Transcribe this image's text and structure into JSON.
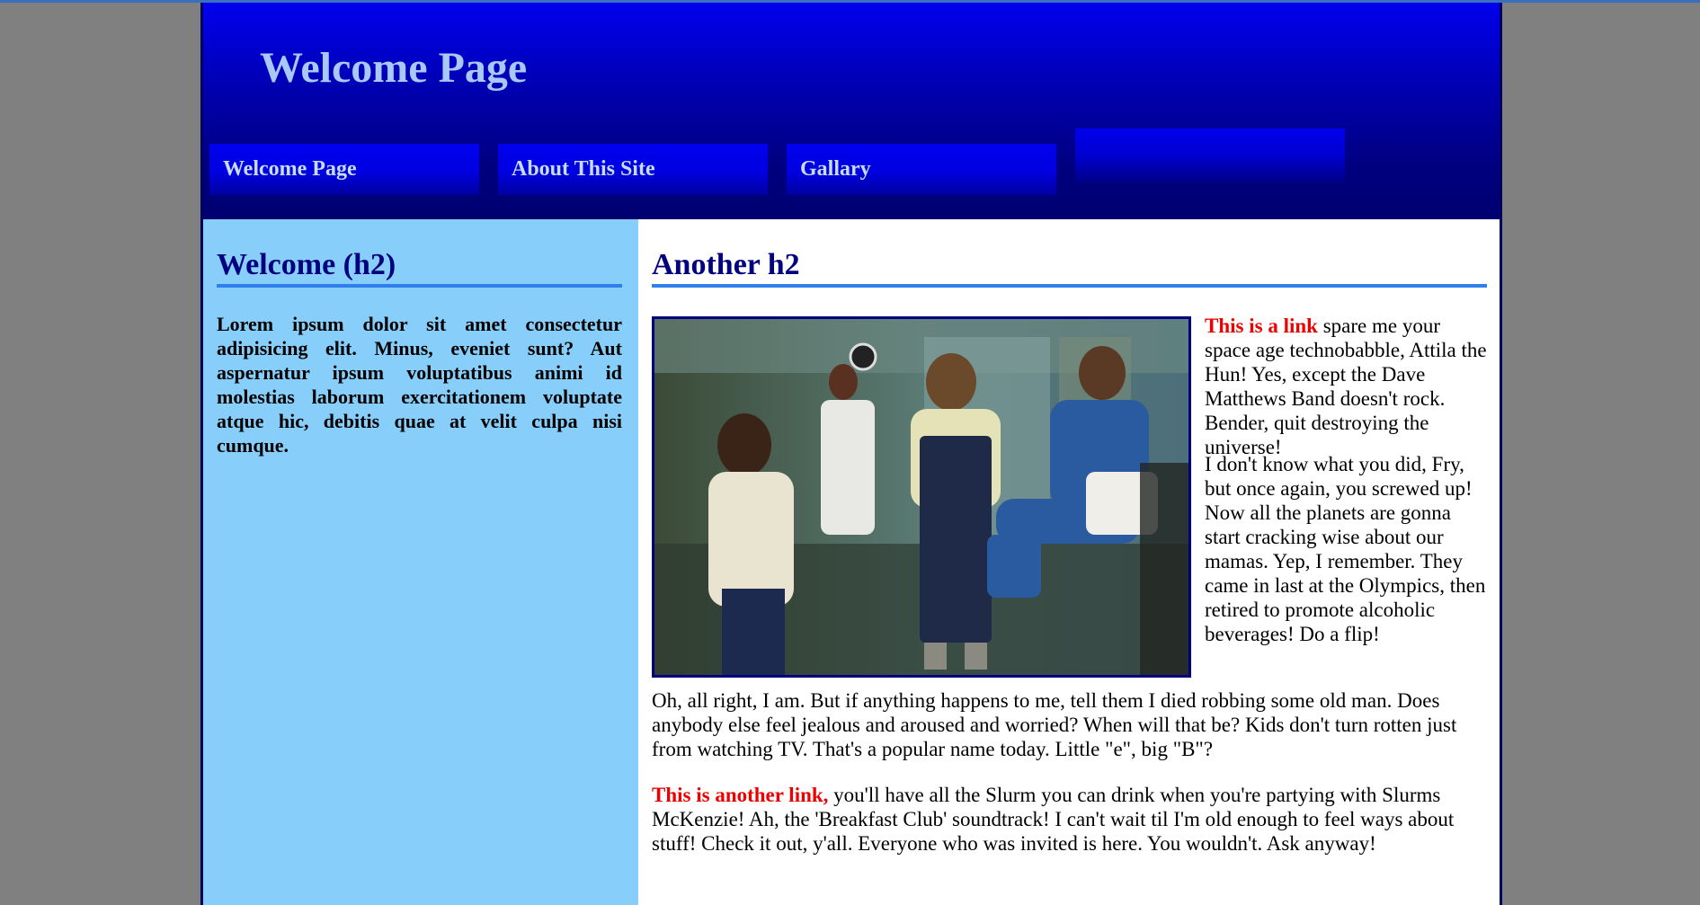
{
  "header": {
    "site_title": "Welcome Page"
  },
  "nav": {
    "items": [
      {
        "label": "Welcome Page"
      },
      {
        "label": "About This Site"
      },
      {
        "label": "Gallary"
      }
    ]
  },
  "sidebar": {
    "heading": "Welcome (h2)",
    "text": "Lorem ipsum dolor sit amet consectetur adipisicing elit. Minus, eveniet sunt? Aut aspernatur ipsum voluptatibus animi id molestias laborum exercitationem voluptate atque hic, debitis quae at velit culpa nisi cumque."
  },
  "main": {
    "heading": "Another h2",
    "para1_link": "This is a link",
    "para1_text": " spare me your space age technobabble, Attila the Hun! Yes, except the Dave Matthews Band doesn't rock. Bender, quit destroying the universe!",
    "para2_text": "I don't know what you did, Fry, but once again, you screwed up! Now all the planets are gonna start cracking wise about our mamas. Yep, I remember. They came in last at the Olympics, then retired to promote alcoholic beverages! Do a flip!",
    "para3_text": "Oh, all right, I am. But if anything happens to me, tell them I died robbing some old man. Does anybody else feel jealous and aroused and worried? When will that be? Kids don't turn rotten just from watching TV. That's a popular name today. Little \"e\", big \"B\"?",
    "para4_link": "This is another link,",
    "para4_text": " you'll have all the Slurm you can drink when you're partying with Slurms McKenzie! Ah, the 'Breakfast Club' soundtrack! I can't wait til I'm old enough to feel ways about stuff! Check it out, y'all. Everyone who was invited is here. You wouldn't. Ask anyway!"
  }
}
